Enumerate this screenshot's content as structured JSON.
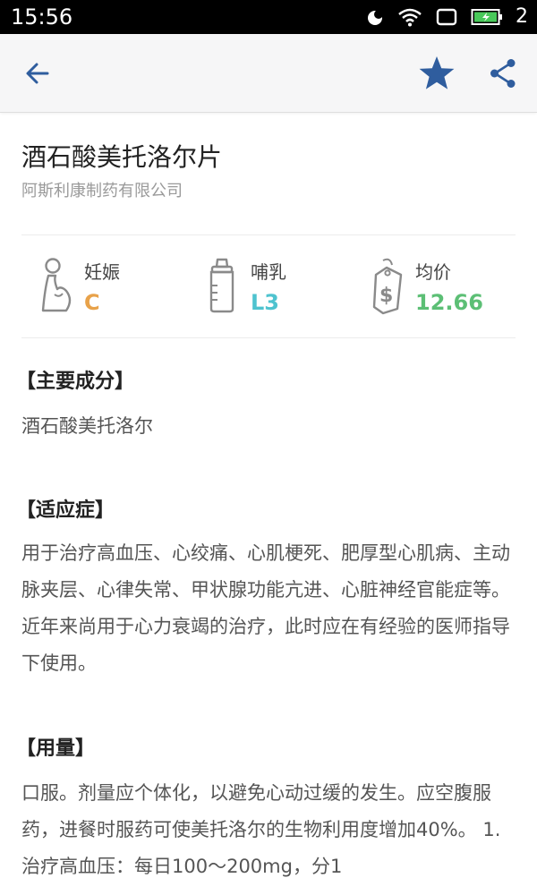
{
  "status_bar": {
    "time": "15:56",
    "sim_slot": "2"
  },
  "drug": {
    "name": "酒石酸美托洛尔片",
    "manufacturer": "阿斯利康制药有限公司"
  },
  "info": {
    "pregnancy": {
      "label": "妊娠",
      "value": "C",
      "color": "#e8a24a"
    },
    "lactation": {
      "label": "哺乳",
      "value": "L3",
      "color": "#4ec3cf"
    },
    "price": {
      "label": "均价",
      "value": "12.66",
      "color": "#5cbf75"
    }
  },
  "sections": {
    "ingredient": {
      "heading": "【主要成分】",
      "body": "酒石酸美托洛尔"
    },
    "indication": {
      "heading": "【适应症】",
      "body": "用于治疗高血压、心绞痛、心肌梗死、肥厚型心肌病、主动脉夹层、心律失常、甲状腺功能亢进、心脏神经官能症等。近年来尚用于心力衰竭的治疗，此时应在有经验的医师指导下使用。"
    },
    "dosage": {
      "heading": "【用量】",
      "body": "口服。剂量应个体化，以避免心动过缓的发生。应空腹服药，进餐时服药可使美托洛尔的生物利用度增加40%。 1. 治疗高血压：每日100～200mg，分1"
    }
  },
  "colors": {
    "accent": "#2f5d9e"
  }
}
